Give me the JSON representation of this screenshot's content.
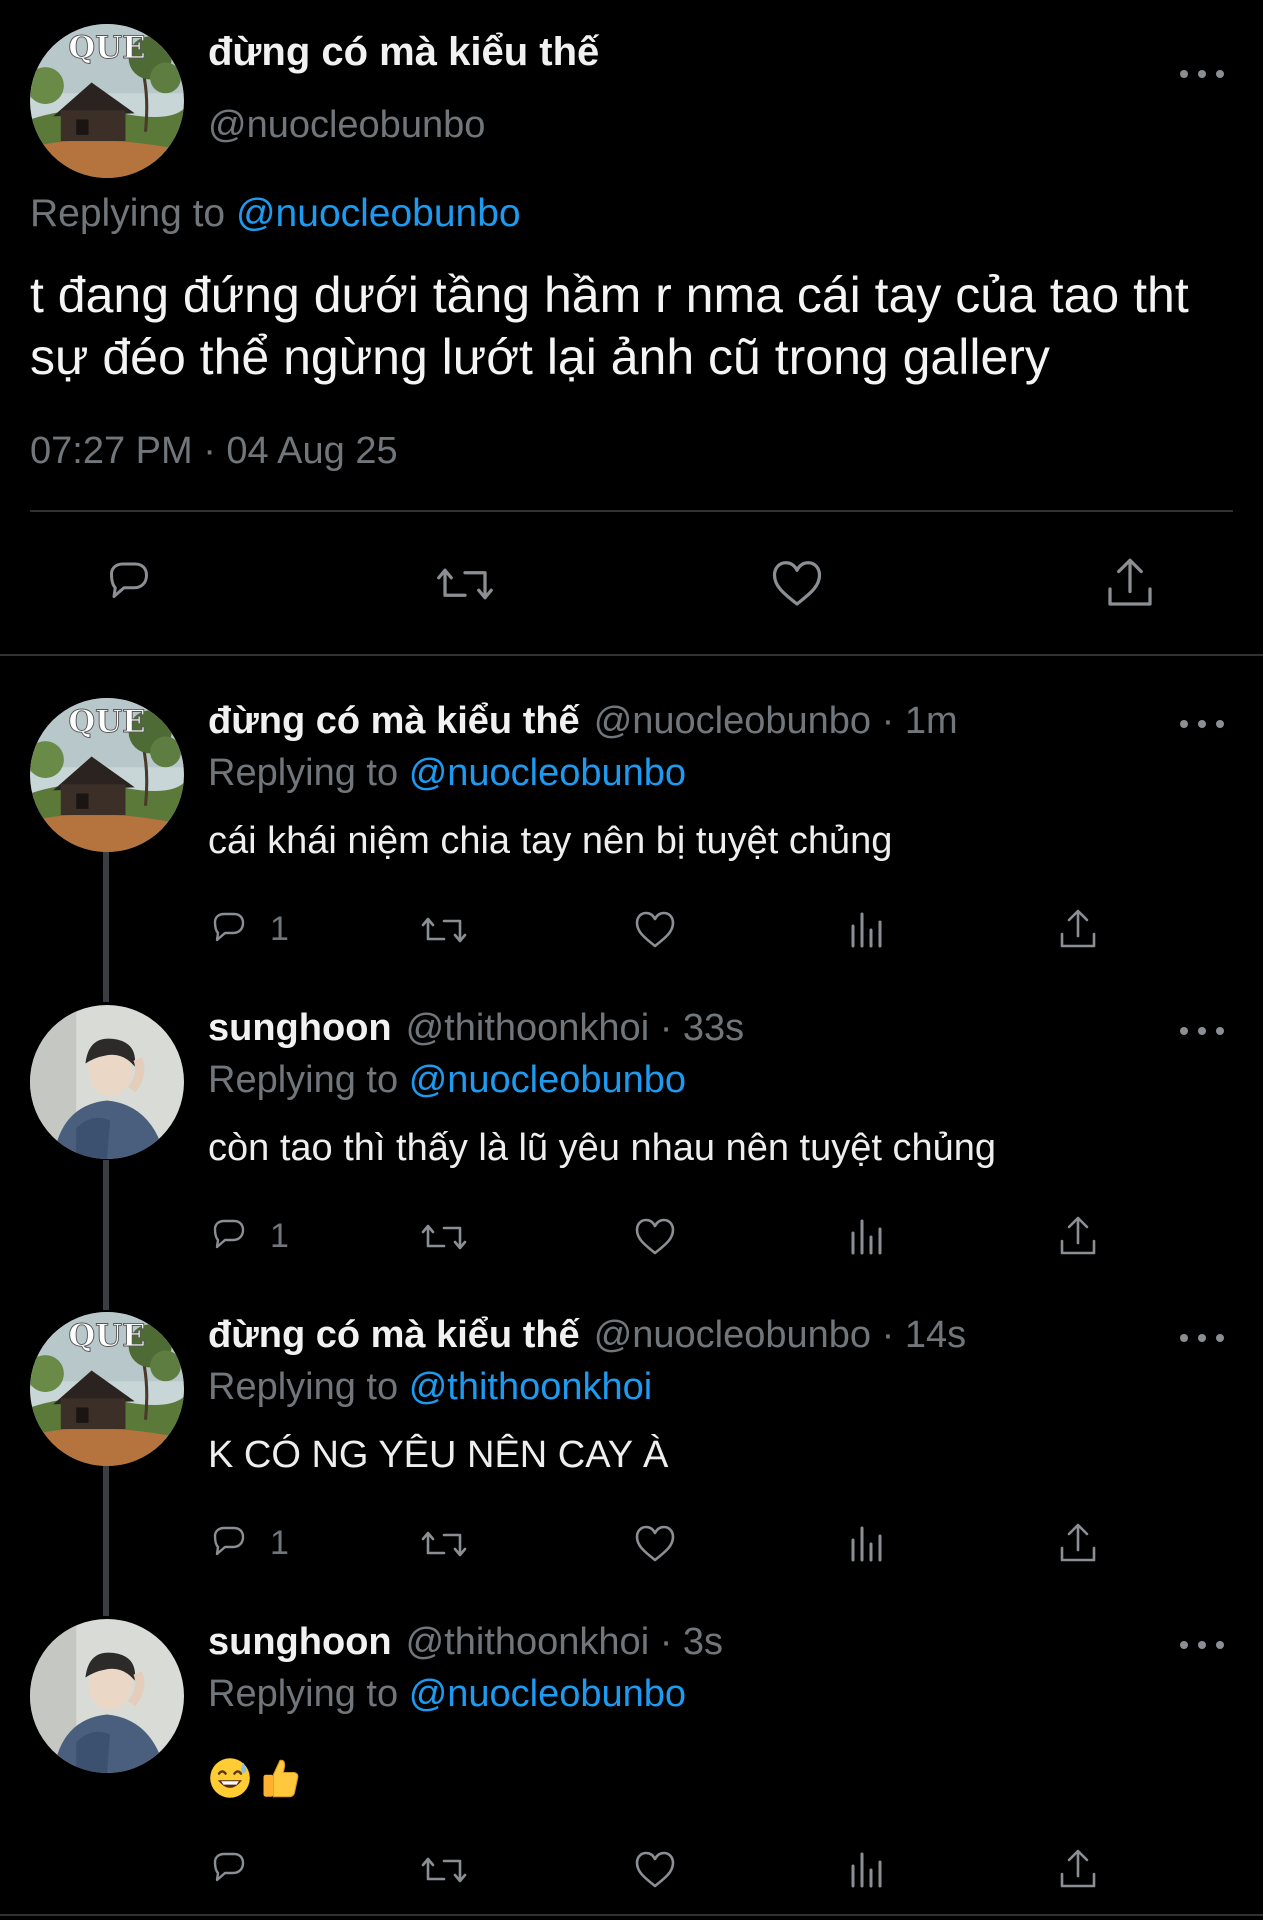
{
  "colors": {
    "background": "#000000",
    "link": "#1d9bf0",
    "muted": "#71767b",
    "divider": "#2f3336"
  },
  "main": {
    "name": "đừng có mà kiểu thế",
    "handle": "@nuocleobunbo",
    "replying_prefix": "Replying to",
    "replying_to": "@nuocleobunbo",
    "text": "t đang đứng dưới tầng hầm r nma cái tay của tao tht sự đéo thể ngừng lướt lại ảnh cũ trong gallery",
    "timestamp": "07:27 PM · 04 Aug 25",
    "avatar_label": "QUE",
    "actions": [
      "reply-icon",
      "retweet-icon",
      "like-icon",
      "share-icon"
    ]
  },
  "replies": [
    {
      "name": "đừng có mà kiểu thế",
      "handle": "@nuocleobunbo",
      "time": "· 1m",
      "replying_prefix": "Replying to",
      "replying_to": "@nuocleobunbo",
      "text": "cái khái niệm chia tay nên bị tuyệt chủng",
      "reply_count": "1",
      "avatar_label": "QUE"
    },
    {
      "name": "sunghoon",
      "handle": "@thithoonkhoi",
      "time": "· 33s",
      "replying_prefix": "Replying to",
      "replying_to": "@nuocleobunbo",
      "text": "còn tao thì thấy là lũ yêu nhau nên tuyệt chủng",
      "reply_count": "1"
    },
    {
      "name": "đừng có mà kiểu thế",
      "handle": "@nuocleobunbo",
      "time": "· 14s",
      "replying_prefix": "Replying to",
      "replying_to": "@thithoonkhoi",
      "text": "K CÓ NG YÊU NÊN CAY À",
      "reply_count": "1",
      "avatar_label": "QUE"
    },
    {
      "name": "sunghoon",
      "handle": "@thithoonkhoi",
      "time": "· 3s",
      "replying_prefix": "Replying to",
      "replying_to": "@nuocleobunbo",
      "emojis": [
        "sweat-smile-emoji",
        "thumbs-up-emoji"
      ],
      "reply_count": ""
    }
  ]
}
